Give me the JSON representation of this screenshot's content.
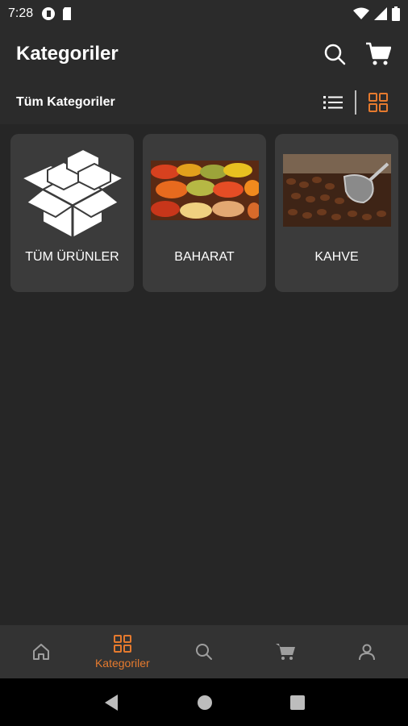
{
  "status_bar": {
    "time": "7:28"
  },
  "app_bar": {
    "title": "Kategoriler",
    "search_icon": "search-icon",
    "cart_icon": "cart-icon"
  },
  "sub_bar": {
    "title": "Tüm Kategoriler",
    "list_view_icon": "list-view-icon",
    "grid_view_icon": "grid-view-icon",
    "active_view": "grid"
  },
  "categories": [
    {
      "label": "TÜM ÜRÜNLER",
      "image": "boxes-image"
    },
    {
      "label": "BAHARAT",
      "image": "spices-photo"
    },
    {
      "label": "KAHVE",
      "image": "coffee-beans-photo"
    }
  ],
  "bottom_nav": {
    "items": [
      {
        "icon": "home-icon",
        "label": ""
      },
      {
        "icon": "grid-icon",
        "label": "Kategoriler"
      },
      {
        "icon": "search-icon",
        "label": ""
      },
      {
        "icon": "cart-icon",
        "label": ""
      },
      {
        "icon": "user-icon",
        "label": ""
      }
    ],
    "active_index": 1
  },
  "colors": {
    "background": "#262626",
    "bar": "#2b2b2b",
    "card": "#3b3b3b",
    "accent": "#e57a2e",
    "inactive_icon": "#9e9e9e"
  }
}
